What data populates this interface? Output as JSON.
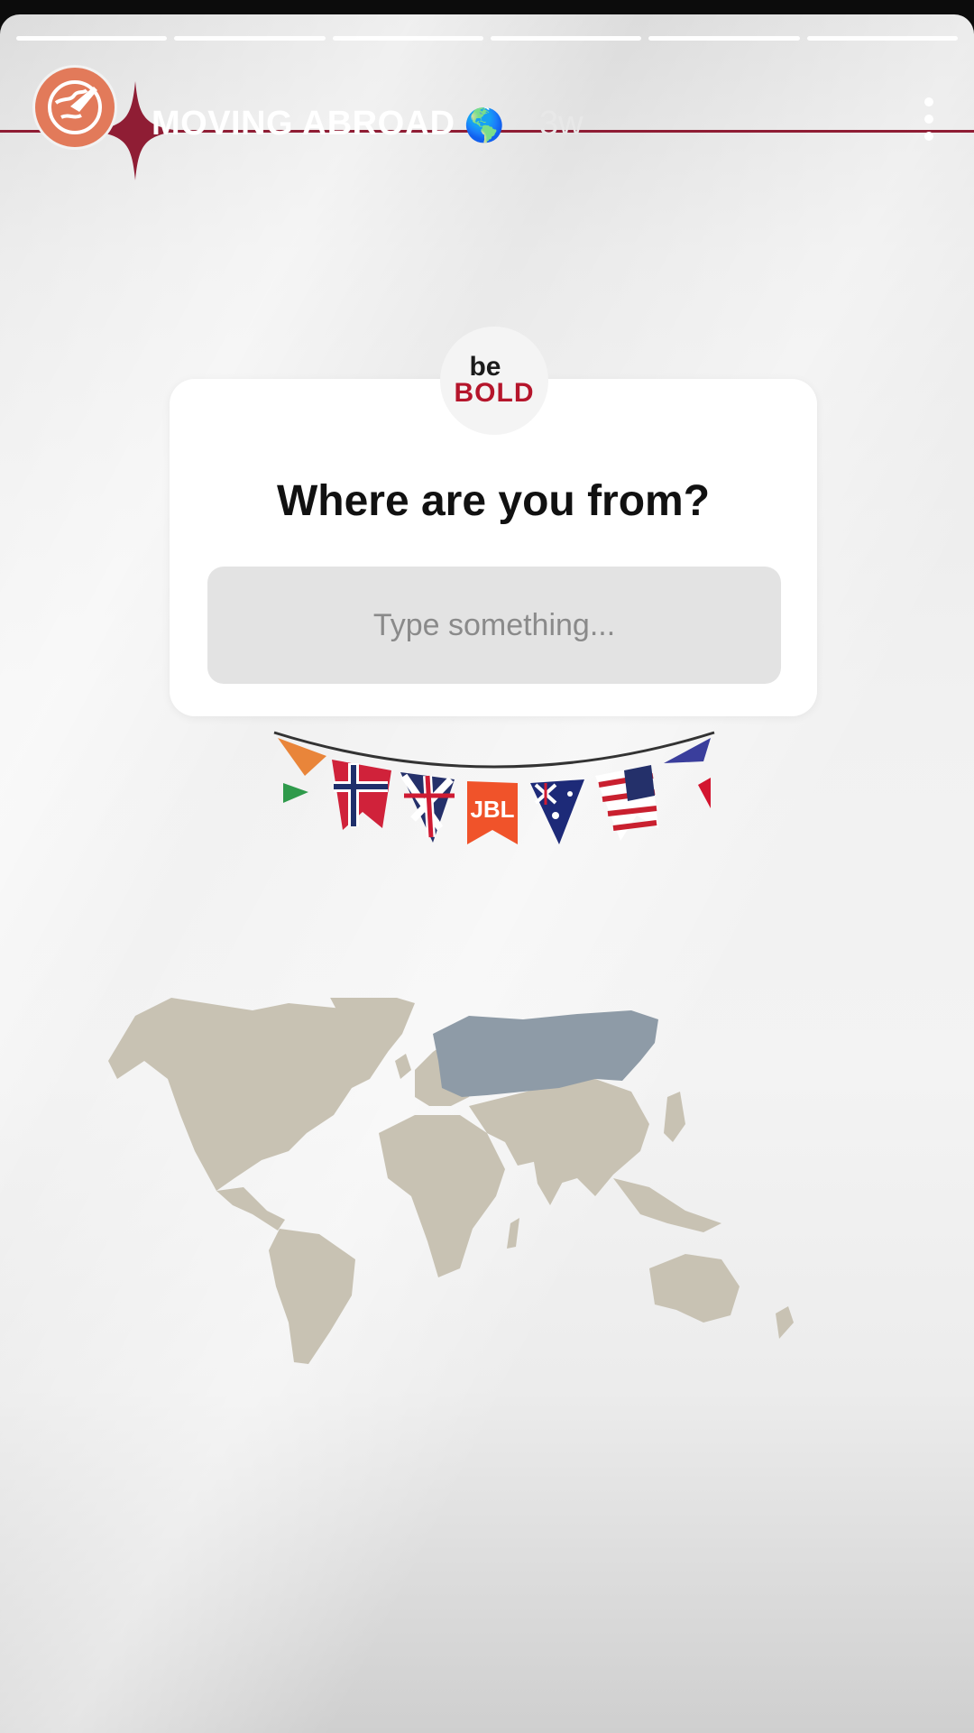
{
  "progress": {
    "segments": 6
  },
  "header": {
    "account_name": "MOVING ABROAD",
    "account_emoji": "🌎",
    "time_ago": "3w"
  },
  "sticker": {
    "logo_top": "be",
    "logo_bottom": "BOLD",
    "question": "Where are you from?",
    "answer_placeholder": "Type something..."
  },
  "bunting": {
    "badge_text": "JBL"
  },
  "colors": {
    "accent_red": "#8f1d34",
    "avatar": "#e27a5a",
    "map_land": "#c8c2b3",
    "map_highlight": "#8e9ba7"
  }
}
